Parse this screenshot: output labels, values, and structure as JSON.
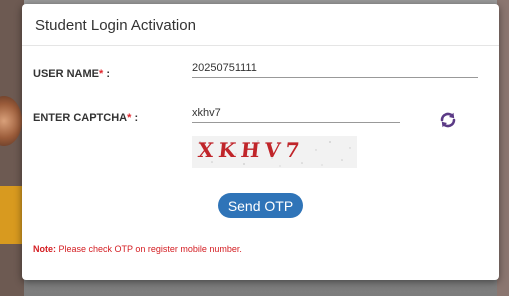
{
  "modal": {
    "title": "Student Login Activation"
  },
  "form": {
    "username_label": "USER NAME",
    "username_required": "*",
    "username_colon": " :",
    "username_value": "20250751111",
    "captcha_label": "ENTER CAPTCHA",
    "captcha_required": "*",
    "captcha_colon": " :",
    "captcha_value": "xkhv7",
    "captcha_image_text": "XKHV7",
    "refresh_icon": "refresh-arrows-icon",
    "send_otp_label": "Send OTP"
  },
  "note": {
    "prefix": "Note:",
    "text": " Please check OTP on register mobile number."
  },
  "colors": {
    "accent": "#2f74b8",
    "required": "#e0262d",
    "refresh_icon": "#5b3a86",
    "note": "#d41d22"
  }
}
